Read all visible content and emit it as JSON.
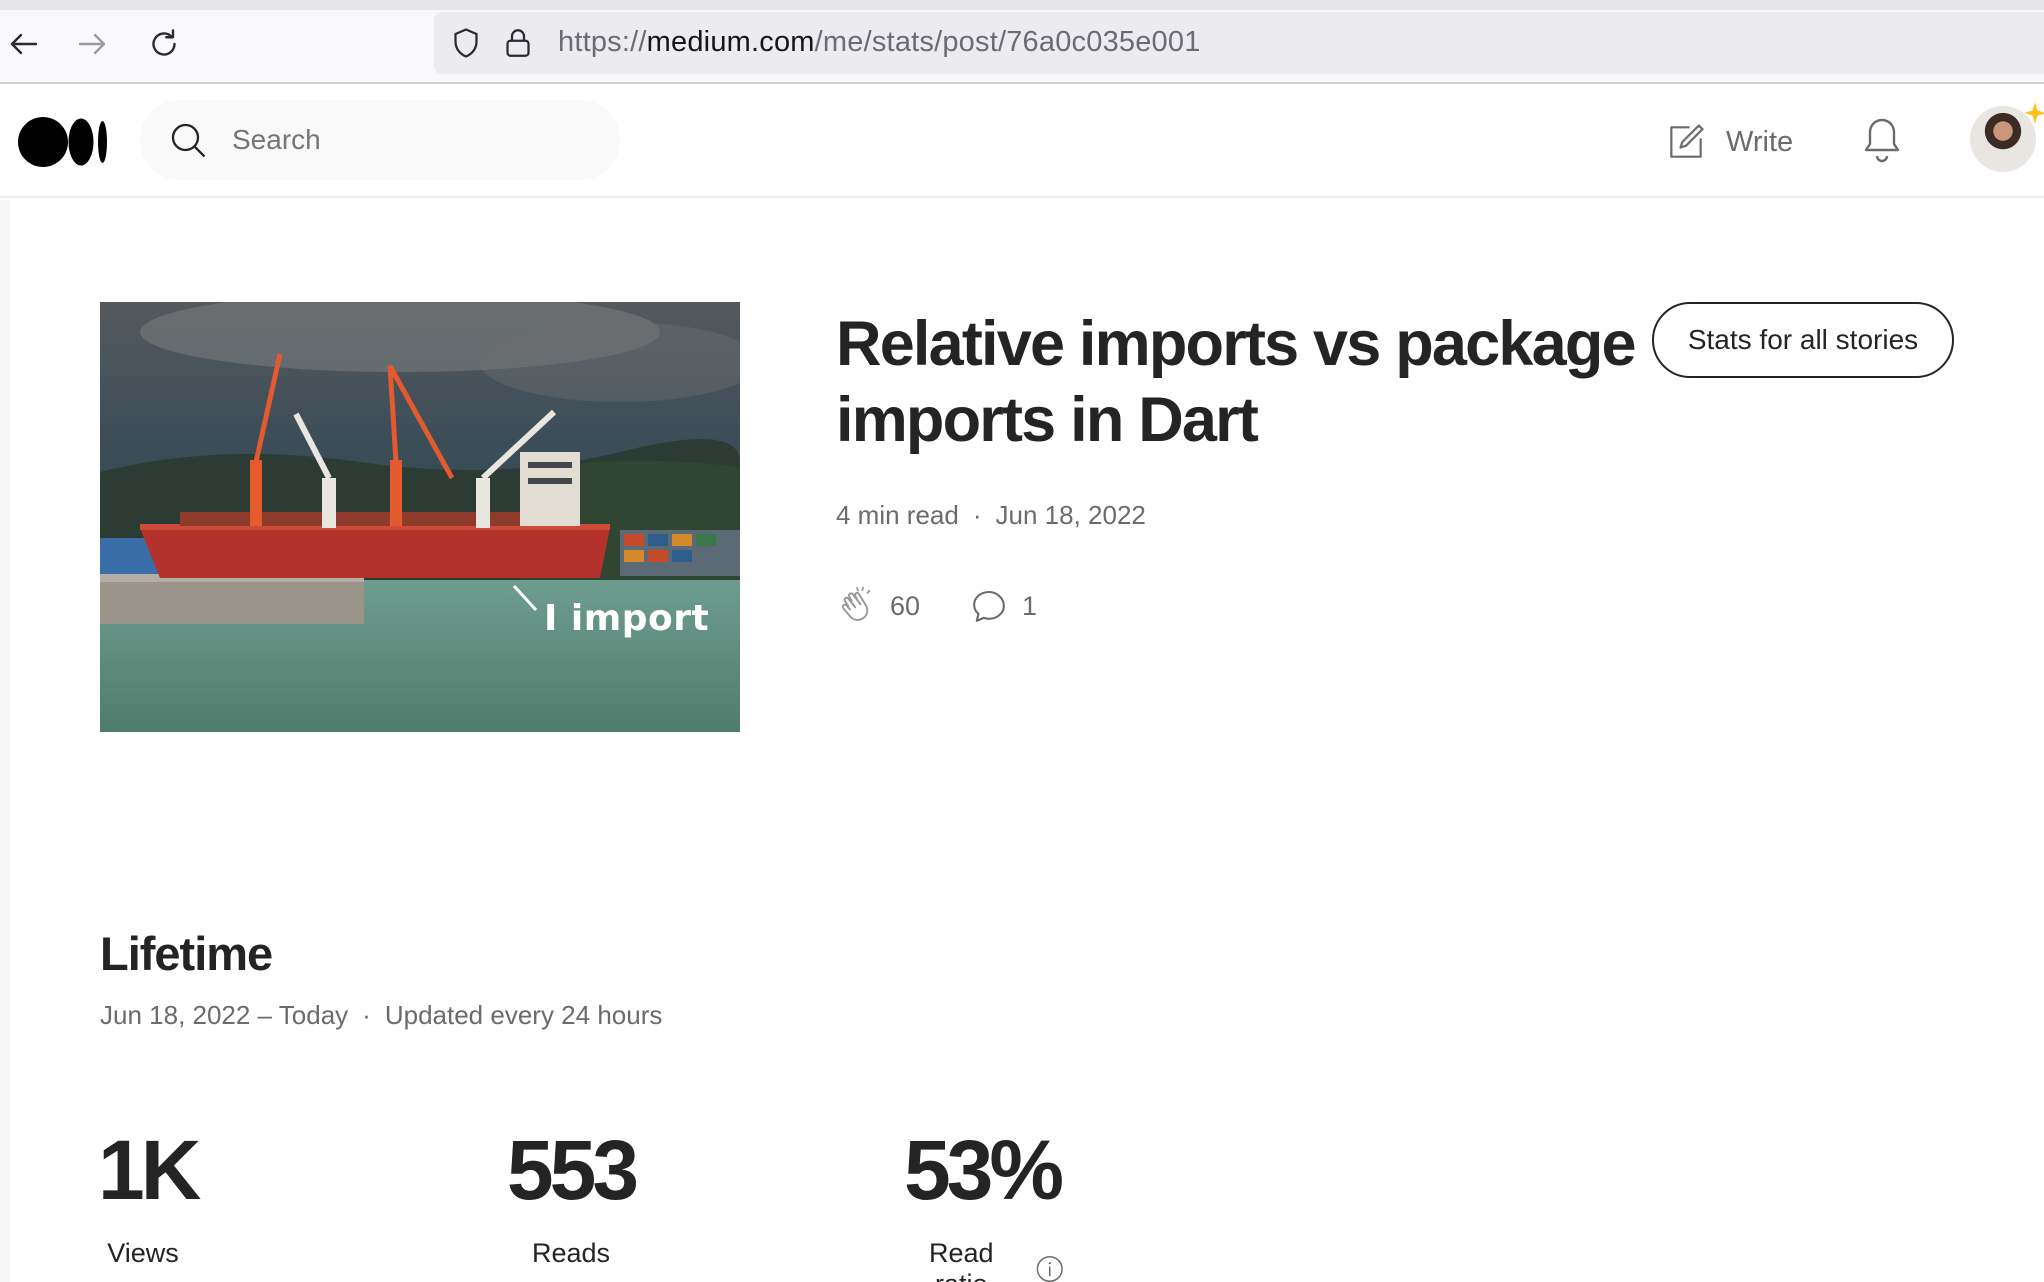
{
  "browser": {
    "url_scheme": "https://",
    "url_domain": "medium.com",
    "url_path": "/me/stats/post/76a0c035e001"
  },
  "header": {
    "search_placeholder": "Search",
    "write_label": "Write"
  },
  "post": {
    "title": "Relative imports vs package imports in Dart",
    "read_time": "4 min read",
    "date": "Jun 18, 2022",
    "claps": "60",
    "responses": "1",
    "cover_caption": "I import",
    "stats_all_label": "Stats for all stories"
  },
  "lifetime": {
    "title": "Lifetime",
    "range": "Jun 18, 2022 – Today",
    "update_note": "Updated every 24 hours",
    "stats": {
      "views": {
        "value": "1K",
        "label": "Views"
      },
      "reads": {
        "value": "553",
        "label": "Reads"
      },
      "read_ratio": {
        "value": "53%",
        "label": "Read ratio"
      }
    }
  },
  "icons": {
    "back": "arrow-left-icon",
    "forward": "arrow-right-icon",
    "reload": "reload-icon",
    "shield": "shield-icon",
    "lock": "lock-icon",
    "search": "search-icon",
    "write": "write-icon",
    "bell": "bell-icon",
    "clap": "clap-icon",
    "response": "comment-icon",
    "info": "info-icon"
  }
}
